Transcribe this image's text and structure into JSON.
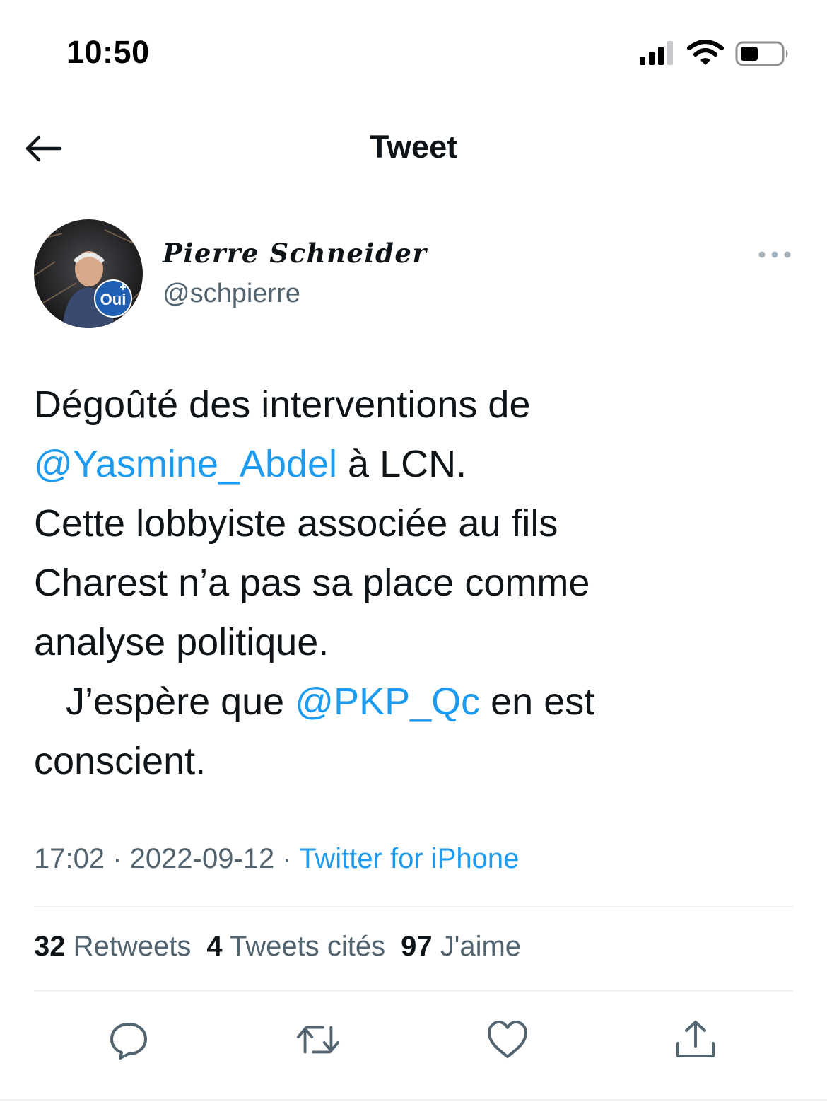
{
  "status_bar": {
    "time": "10:50"
  },
  "nav": {
    "title": "Tweet"
  },
  "tweet": {
    "author": {
      "name": "Pierre Schneider",
      "handle": "@schpierre",
      "avatar_badge": "Oui"
    },
    "text_lines": [
      [
        {
          "t": "Dégoûté des interventions de"
        }
      ],
      [
        {
          "t": "@Yasmine_Abdel",
          "mention": true
        },
        {
          "t": " à LCN."
        }
      ],
      [
        {
          "t": "Cette lobbyiste associée au fils"
        }
      ],
      [
        {
          "t": "Charest n’a pas sa place comme"
        }
      ],
      [
        {
          "t": "analyse politique."
        }
      ],
      [
        {
          "t": "   J’espère que "
        },
        {
          "t": "@PKP_Qc",
          "mention": true
        },
        {
          "t": " en est"
        }
      ],
      [
        {
          "t": "conscient."
        }
      ]
    ],
    "time": "17:02",
    "date": "2022-09-12",
    "separator": " · ",
    "source": "Twitter for iPhone",
    "stats": {
      "retweets_count": "32",
      "retweets_label": "Retweets",
      "quotes_count": "4",
      "quotes_label": "Tweets cités",
      "likes_count": "97",
      "likes_label": "J'aime"
    }
  },
  "icons": {
    "back": "arrow-left-icon",
    "more": "more-horizontal-icon",
    "reply": "reply-icon",
    "retweet": "retweet-icon",
    "like": "heart-icon",
    "share": "share-icon"
  },
  "colors": {
    "link": "#1d9bf0",
    "text": "#0f1419",
    "secondary": "#536471",
    "divider": "#eff3f4"
  }
}
